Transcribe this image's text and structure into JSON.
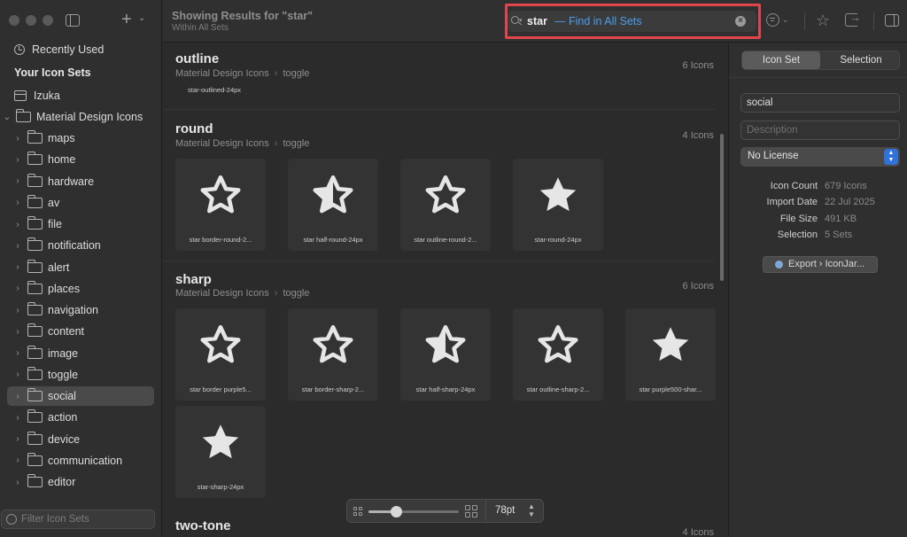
{
  "sidebar": {
    "recent": "Recently Used",
    "heading": "Your Icon Sets",
    "sets": [
      {
        "label": "Izuka"
      },
      {
        "label": "Material Design Icons"
      }
    ],
    "folders": [
      "maps",
      "home",
      "hardware",
      "av",
      "file",
      "notification",
      "alert",
      "places",
      "navigation",
      "content",
      "image",
      "toggle",
      "social",
      "action",
      "device",
      "communication",
      "editor"
    ],
    "selected_folder": "social",
    "filter_placeholder": "Filter Icon Sets"
  },
  "toolbar": {
    "title": "Showing Results for \"star\"",
    "subtitle": "Within All Sets",
    "search_term": "star",
    "search_scope": "— Find in All Sets"
  },
  "sections": [
    {
      "title": "outline",
      "set": "Material Design Icons",
      "category": "toggle",
      "count": "6 Icons",
      "visible_label": "star-outlined-24px"
    },
    {
      "title": "round",
      "set": "Material Design Icons",
      "category": "toggle",
      "count": "4 Icons",
      "icons": [
        {
          "label": "star border-round-2...",
          "kind": "outline"
        },
        {
          "label": "star half-round-24px",
          "kind": "half"
        },
        {
          "label": "star outline-round-2...",
          "kind": "outline"
        },
        {
          "label": "star-round-24px",
          "kind": "filled"
        }
      ]
    },
    {
      "title": "sharp",
      "set": "Material Design Icons",
      "category": "toggle",
      "count": "6 Icons",
      "icons": [
        {
          "label": "star border purple5...",
          "kind": "outline"
        },
        {
          "label": "star border-sharp-2...",
          "kind": "outline"
        },
        {
          "label": "star half-sharp-24px",
          "kind": "half"
        },
        {
          "label": "star outline-sharp-2...",
          "kind": "outline"
        },
        {
          "label": "star purple500-shar...",
          "kind": "filled"
        },
        {
          "label": "star-sharp-24px",
          "kind": "filled"
        }
      ]
    },
    {
      "title": "two-tone",
      "count": "4 Icons"
    }
  ],
  "zoom": {
    "value": "78pt",
    "level": 0.3
  },
  "inspector": {
    "tabs": [
      "Icon Set",
      "Selection"
    ],
    "active_tab": "Icon Set",
    "name_value": "social",
    "description_placeholder": "Description",
    "license": "No License",
    "meta": [
      {
        "key": "Icon Count",
        "value": "679 Icons"
      },
      {
        "key": "Import Date",
        "value": "22 Jul 2025"
      },
      {
        "key": "File Size",
        "value": "491 KB"
      },
      {
        "key": "Selection",
        "value": "5 Sets"
      }
    ],
    "export_label": "Export › IconJar..."
  },
  "colors": {
    "accent_blue": "#4a9ff0",
    "highlight_red": "#e1454e",
    "select_blue": "#2f72d9"
  }
}
